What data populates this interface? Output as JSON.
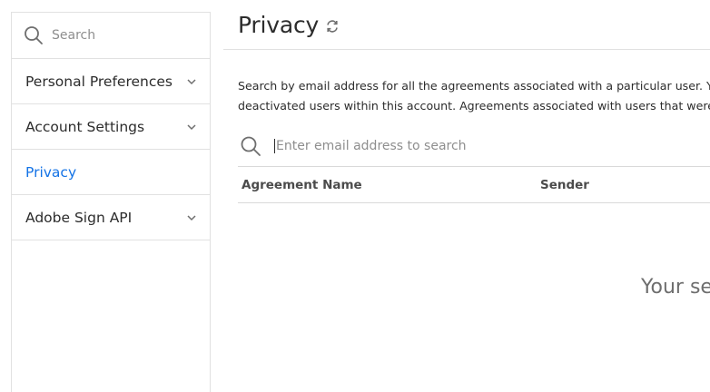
{
  "sidebar": {
    "search_placeholder": "Search",
    "items": [
      {
        "label": "Personal Preferences",
        "has_chevron": true
      },
      {
        "label": "Account Settings",
        "has_chevron": true
      },
      {
        "label": "Privacy",
        "active": true
      },
      {
        "label": "Adobe Sign API",
        "has_chevron": true
      }
    ]
  },
  "main": {
    "title": "Privacy",
    "description_line1": "Search by email address for all the agreements associated with a particular user. You c",
    "description_line2": "deactivated users within this account. Agreements associated with users that were rem",
    "search_placeholder": "Enter email address to search",
    "table_headers": [
      "Agreement Name",
      "Sender"
    ],
    "empty_message": "Your se"
  },
  "colors": {
    "accent": "#1473e6",
    "border": "#e1e1e1",
    "text": "#2c2c2c",
    "muted": "#8e8e8e"
  }
}
